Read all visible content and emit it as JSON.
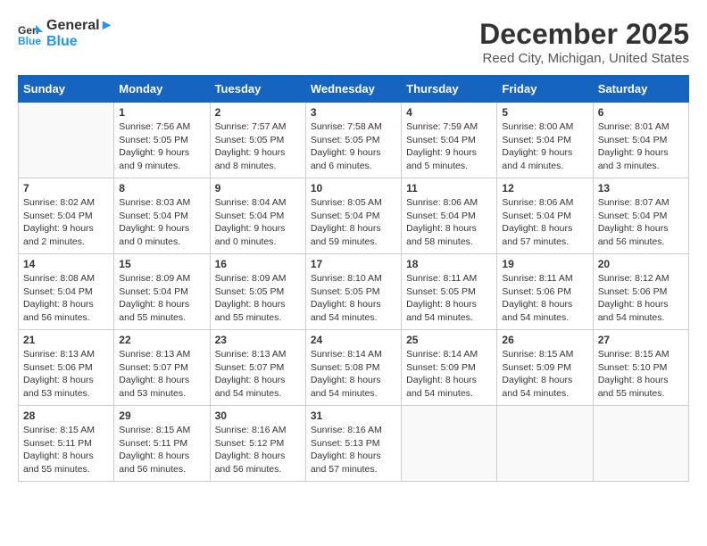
{
  "logo": {
    "line1": "General",
    "line2": "Blue"
  },
  "title": "December 2025",
  "location": "Reed City, Michigan, United States",
  "days_of_week": [
    "Sunday",
    "Monday",
    "Tuesday",
    "Wednesday",
    "Thursday",
    "Friday",
    "Saturday"
  ],
  "weeks": [
    [
      {
        "day": "",
        "info": ""
      },
      {
        "day": "1",
        "info": "Sunrise: 7:56 AM\nSunset: 5:05 PM\nDaylight: 9 hours\nand 9 minutes."
      },
      {
        "day": "2",
        "info": "Sunrise: 7:57 AM\nSunset: 5:05 PM\nDaylight: 9 hours\nand 8 minutes."
      },
      {
        "day": "3",
        "info": "Sunrise: 7:58 AM\nSunset: 5:05 PM\nDaylight: 9 hours\nand 6 minutes."
      },
      {
        "day": "4",
        "info": "Sunrise: 7:59 AM\nSunset: 5:04 PM\nDaylight: 9 hours\nand 5 minutes."
      },
      {
        "day": "5",
        "info": "Sunrise: 8:00 AM\nSunset: 5:04 PM\nDaylight: 9 hours\nand 4 minutes."
      },
      {
        "day": "6",
        "info": "Sunrise: 8:01 AM\nSunset: 5:04 PM\nDaylight: 9 hours\nand 3 minutes."
      }
    ],
    [
      {
        "day": "7",
        "info": "Sunrise: 8:02 AM\nSunset: 5:04 PM\nDaylight: 9 hours\nand 2 minutes."
      },
      {
        "day": "8",
        "info": "Sunrise: 8:03 AM\nSunset: 5:04 PM\nDaylight: 9 hours\nand 0 minutes."
      },
      {
        "day": "9",
        "info": "Sunrise: 8:04 AM\nSunset: 5:04 PM\nDaylight: 9 hours\nand 0 minutes."
      },
      {
        "day": "10",
        "info": "Sunrise: 8:05 AM\nSunset: 5:04 PM\nDaylight: 8 hours\nand 59 minutes."
      },
      {
        "day": "11",
        "info": "Sunrise: 8:06 AM\nSunset: 5:04 PM\nDaylight: 8 hours\nand 58 minutes."
      },
      {
        "day": "12",
        "info": "Sunrise: 8:06 AM\nSunset: 5:04 PM\nDaylight: 8 hours\nand 57 minutes."
      },
      {
        "day": "13",
        "info": "Sunrise: 8:07 AM\nSunset: 5:04 PM\nDaylight: 8 hours\nand 56 minutes."
      }
    ],
    [
      {
        "day": "14",
        "info": "Sunrise: 8:08 AM\nSunset: 5:04 PM\nDaylight: 8 hours\nand 56 minutes."
      },
      {
        "day": "15",
        "info": "Sunrise: 8:09 AM\nSunset: 5:04 PM\nDaylight: 8 hours\nand 55 minutes."
      },
      {
        "day": "16",
        "info": "Sunrise: 8:09 AM\nSunset: 5:05 PM\nDaylight: 8 hours\nand 55 minutes."
      },
      {
        "day": "17",
        "info": "Sunrise: 8:10 AM\nSunset: 5:05 PM\nDaylight: 8 hours\nand 54 minutes."
      },
      {
        "day": "18",
        "info": "Sunrise: 8:11 AM\nSunset: 5:05 PM\nDaylight: 8 hours\nand 54 minutes."
      },
      {
        "day": "19",
        "info": "Sunrise: 8:11 AM\nSunset: 5:06 PM\nDaylight: 8 hours\nand 54 minutes."
      },
      {
        "day": "20",
        "info": "Sunrise: 8:12 AM\nSunset: 5:06 PM\nDaylight: 8 hours\nand 54 minutes."
      }
    ],
    [
      {
        "day": "21",
        "info": "Sunrise: 8:13 AM\nSunset: 5:06 PM\nDaylight: 8 hours\nand 53 minutes."
      },
      {
        "day": "22",
        "info": "Sunrise: 8:13 AM\nSunset: 5:07 PM\nDaylight: 8 hours\nand 53 minutes."
      },
      {
        "day": "23",
        "info": "Sunrise: 8:13 AM\nSunset: 5:07 PM\nDaylight: 8 hours\nand 54 minutes."
      },
      {
        "day": "24",
        "info": "Sunrise: 8:14 AM\nSunset: 5:08 PM\nDaylight: 8 hours\nand 54 minutes."
      },
      {
        "day": "25",
        "info": "Sunrise: 8:14 AM\nSunset: 5:09 PM\nDaylight: 8 hours\nand 54 minutes."
      },
      {
        "day": "26",
        "info": "Sunrise: 8:15 AM\nSunset: 5:09 PM\nDaylight: 8 hours\nand 54 minutes."
      },
      {
        "day": "27",
        "info": "Sunrise: 8:15 AM\nSunset: 5:10 PM\nDaylight: 8 hours\nand 55 minutes."
      }
    ],
    [
      {
        "day": "28",
        "info": "Sunrise: 8:15 AM\nSunset: 5:11 PM\nDaylight: 8 hours\nand 55 minutes."
      },
      {
        "day": "29",
        "info": "Sunrise: 8:15 AM\nSunset: 5:11 PM\nDaylight: 8 hours\nand 56 minutes."
      },
      {
        "day": "30",
        "info": "Sunrise: 8:16 AM\nSunset: 5:12 PM\nDaylight: 8 hours\nand 56 minutes."
      },
      {
        "day": "31",
        "info": "Sunrise: 8:16 AM\nSunset: 5:13 PM\nDaylight: 8 hours\nand 57 minutes."
      },
      {
        "day": "",
        "info": ""
      },
      {
        "day": "",
        "info": ""
      },
      {
        "day": "",
        "info": ""
      }
    ]
  ]
}
